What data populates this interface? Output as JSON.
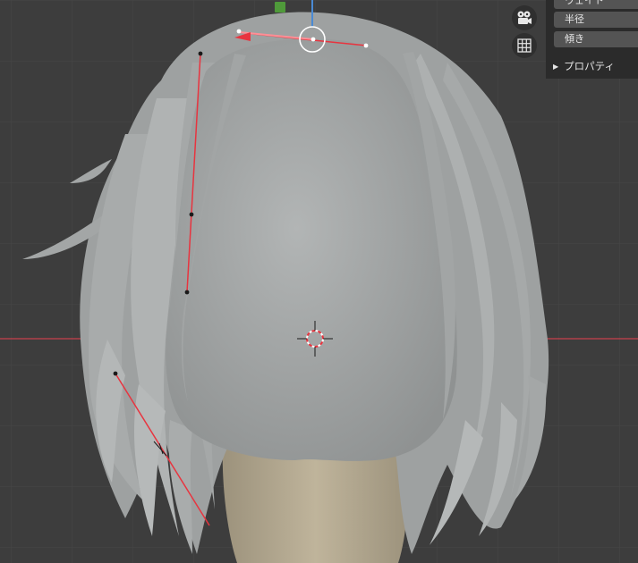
{
  "properties": {
    "fields": [
      {
        "label": "ウェイト"
      },
      {
        "label": "半径"
      },
      {
        "label": "傾き"
      }
    ],
    "panel_label": "プロパティ"
  },
  "icons": {
    "camera": "camera-icon",
    "grid": "grid-icon",
    "panel_arrow": "▶"
  },
  "colors": {
    "viewport_bg": "#3d3d3d",
    "mesh": "#a9acac",
    "neck": "#b8ad95",
    "curve_selected": "#e8343f",
    "x_axis": "#d4424c",
    "z_axis": "#4a8ad4",
    "gizmo_green": "#4f9a3a"
  }
}
